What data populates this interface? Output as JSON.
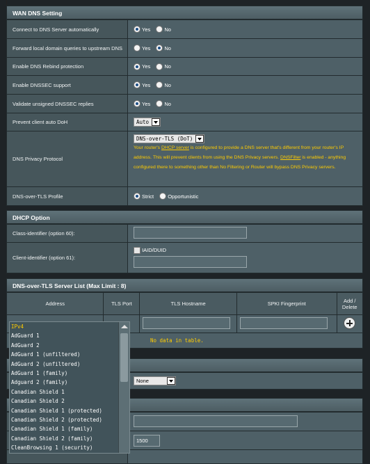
{
  "wan_dns": {
    "title": "WAN DNS Setting",
    "yes": "Yes",
    "no": "No",
    "rows": [
      {
        "label": "Connect to DNS Server automatically",
        "value": "Yes"
      },
      {
        "label": "Forward local domain queries to upstream DNS",
        "value": "No"
      },
      {
        "label": "Enable DNS Rebind protection",
        "value": "Yes"
      },
      {
        "label": "Enable DNSSEC support",
        "value": "Yes"
      },
      {
        "label": "Validate unsigned DNSSEC replies",
        "value": "Yes"
      }
    ],
    "doh_label": "Prevent client auto DoH",
    "doh_value": "Auto",
    "privacy_label": "DNS Privacy Protocol",
    "privacy_value": "DNS-over-TLS (DoT)",
    "privacy_note_1": "Your router's ",
    "privacy_note_link1": "DHCP server",
    "privacy_note_2": " is configured to provide a DNS server that's different from your router's IP address. This will prevent clients from using the DNS Privacy servers.",
    "privacy_note_link2": "DNSFilter",
    "privacy_note_3": " is enabled - anything configured there to something other than No Filtering or Router will bypass DNS Privacy servers.",
    "profile_label": "DNS-over-TLS Profile",
    "profile_strict": "Strict",
    "profile_opportunistic": "Opportunistic"
  },
  "dhcp": {
    "title": "DHCP Option",
    "class_label": "Class-identifier (option 60):",
    "client_label": "Client-identifier (option 61):",
    "iaid_label": "IAID/DUID"
  },
  "dot_list": {
    "title": "DNS-over-TLS Server List (Max Limit : 8)",
    "col_address": "Address",
    "col_port": "TLS Port",
    "col_hostname": "TLS Hostname",
    "col_spki": "SPKI Fingerprint",
    "col_add": "Add / Delete",
    "no_data": "No data in table."
  },
  "lower": {
    "select_value": "None",
    "mtu_value": "1500"
  },
  "dropdown_items": [
    "IPv4",
    "AdGuard 1",
    "AdGuard 2",
    "AdGuard 1 (unfiltered)",
    "AdGuard 2 (unfiltered)",
    "AdGuard 1 (family)",
    "Adguard 2 (family)",
    "Canadian Shield 1",
    "Canadian Shield 2",
    "Canadian Shield 1 (protected)",
    "Canadian Shield 2 (protected)",
    "Canadian Shield 1 (family)",
    "Canadian Shield 2 (family)",
    "CleanBrowsing 1 (security)"
  ],
  "colors": {
    "accent_note": "#ffcc00",
    "section_header": "#5f7279",
    "label_cell": "#46565b",
    "value_cell": "#4e6067"
  }
}
